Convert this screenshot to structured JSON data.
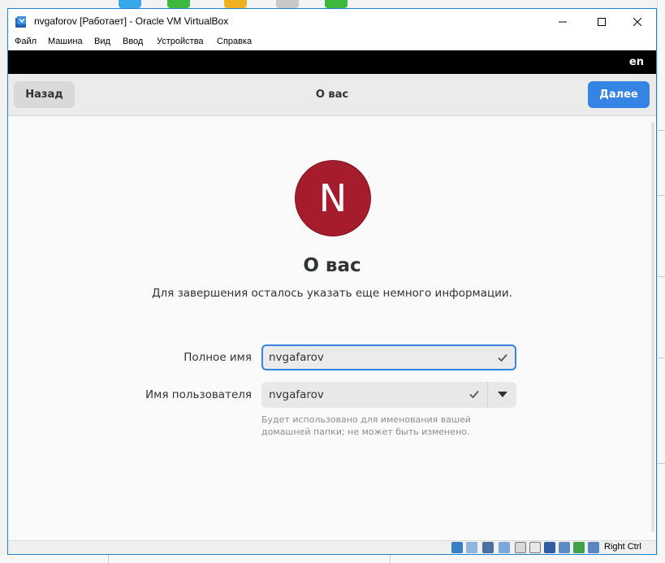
{
  "window": {
    "title": "nvgaforov [Работает] - Oracle VM VirtualBox"
  },
  "menu": {
    "items": [
      "Файл",
      "Машина",
      "Вид",
      "Ввод",
      "Устройства",
      "Справка"
    ]
  },
  "guest": {
    "topbar": {
      "language": "en"
    },
    "header": {
      "back_label": "Назад",
      "title": "О вас",
      "next_label": "Далее"
    },
    "avatar": {
      "initial": "N",
      "color": "#a51d2d"
    },
    "page": {
      "heading": "О вас",
      "subtitle": "Для завершения осталось указать еще немного информации."
    },
    "form": {
      "full_name": {
        "label": "Полное имя",
        "value": "nvgafarov"
      },
      "username": {
        "label": "Имя пользователя",
        "value": "nvgafarov"
      },
      "hint": "Будет использовано для именования вашей домашней папки; не может быть изменено."
    }
  },
  "statusbar": {
    "host_key": "Right Ctrl"
  },
  "colors": {
    "accent": "#3584e4",
    "window_border": "#1883d7"
  }
}
